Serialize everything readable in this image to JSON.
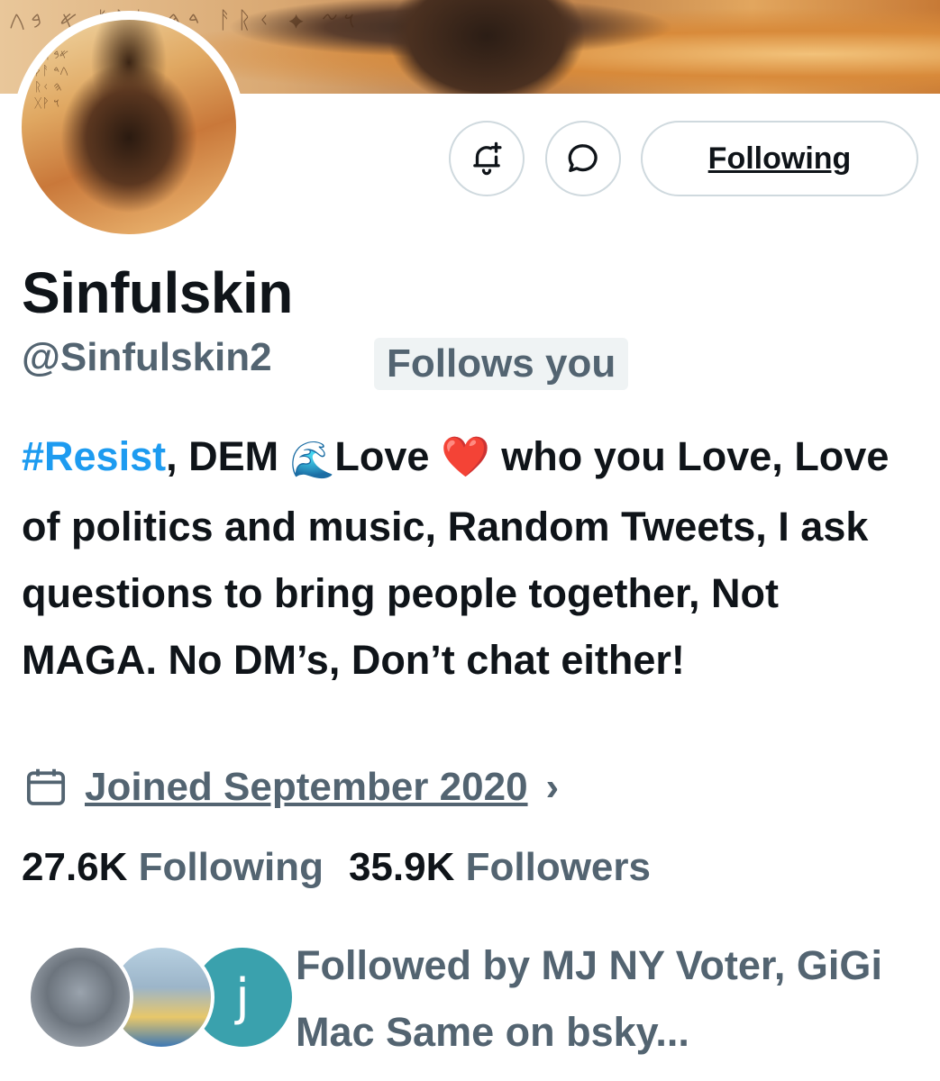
{
  "profile": {
    "display_name": "Sinfulskin",
    "handle": "@Sinfulskin2",
    "follows_you_badge": "Follows you",
    "bio": {
      "hashtag": "#Resist",
      "after_hashtag": ", DEM ",
      "wave_emoji": "🌊",
      "love_text": "Love ",
      "heart_emoji": "❤️",
      "rest_line1": " who you",
      "rest": "Love, Love of politics and music, Random Tweets, I ask questions to bring people together, Not MAGA. No DM’s, Don’t chat either!"
    },
    "joined": "Joined September 2020",
    "joined_chevron": "›",
    "stats": {
      "following_count": "27.6K",
      "following_label": "Following",
      "followers_count": "35.9K",
      "followers_label": "Followers"
    },
    "followed_by": "Followed by MJ NY Voter, GiGi Mac Same on bsky..."
  },
  "actions": {
    "notify_icon": "bell-plus-icon",
    "message_icon": "chat-bubble-icon",
    "following_button": "Following"
  },
  "followed_by_avatars": [
    {
      "name": "cat-avatar"
    },
    {
      "name": "landscape-avatar"
    },
    {
      "name": "letter-avatar",
      "letter": "j"
    }
  ],
  "colors": {
    "accent": "#1d9bf0",
    "secondary_text": "#536471",
    "primary_text": "#0f1419",
    "border": "#cfd9de",
    "badge_bg": "#eff3f4"
  }
}
